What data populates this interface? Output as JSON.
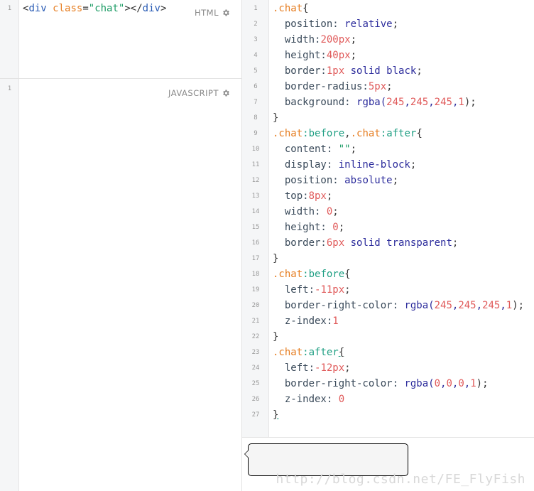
{
  "html_pane": {
    "label": "HTML",
    "line_numbers": [
      "1"
    ],
    "code": {
      "open_lt": "<",
      "tag": "div",
      "space": " ",
      "attr": "class",
      "eq": "=",
      "value": "\"chat\"",
      "close_gt": ">",
      "end_tag_open": "</",
      "end_tag": "div",
      "end_gt": ">"
    }
  },
  "js_pane": {
    "label": "JAVASCRIPT",
    "line_numbers": [
      "1"
    ]
  },
  "css_pane": {
    "line_numbers": [
      "1",
      "2",
      "3",
      "4",
      "5",
      "6",
      "7",
      "8",
      "9",
      "10",
      "11",
      "12",
      "13",
      "14",
      "15",
      "16",
      "17",
      "18",
      "19",
      "20",
      "21",
      "22",
      "23",
      "24",
      "25",
      "26",
      "27"
    ],
    "lines": [
      [
        {
          "t": ".chat",
          "c": "t-sel"
        },
        {
          "t": "{",
          "c": "t-punc"
        }
      ],
      [
        {
          "t": "  position: ",
          "c": "t-prop"
        },
        {
          "t": "relative",
          "c": "t-kw"
        },
        {
          "t": ";",
          "c": "t-punc"
        }
      ],
      [
        {
          "t": "  width:",
          "c": "t-prop"
        },
        {
          "t": "200px",
          "c": "t-num"
        },
        {
          "t": ";",
          "c": "t-punc"
        }
      ],
      [
        {
          "t": "  height:",
          "c": "t-prop"
        },
        {
          "t": "40px",
          "c": "t-num"
        },
        {
          "t": ";",
          "c": "t-punc"
        }
      ],
      [
        {
          "t": "  border:",
          "c": "t-prop"
        },
        {
          "t": "1px",
          "c": "t-num"
        },
        {
          "t": " solid ",
          "c": "t-kw"
        },
        {
          "t": "black",
          "c": "t-kw"
        },
        {
          "t": ";",
          "c": "t-punc"
        }
      ],
      [
        {
          "t": "  border-radius:",
          "c": "t-prop"
        },
        {
          "t": "5px",
          "c": "t-num"
        },
        {
          "t": ";",
          "c": "t-punc"
        }
      ],
      [
        {
          "t": "  background: ",
          "c": "t-prop"
        },
        {
          "t": "rgba(",
          "c": "t-kw"
        },
        {
          "t": "245",
          "c": "t-num"
        },
        {
          "t": ",",
          "c": "t-kw"
        },
        {
          "t": "245",
          "c": "t-num"
        },
        {
          "t": ",",
          "c": "t-kw"
        },
        {
          "t": "245",
          "c": "t-num"
        },
        {
          "t": ",",
          "c": "t-kw"
        },
        {
          "t": "1",
          "c": "t-num"
        },
        {
          "t": ");",
          "c": "t-punc"
        }
      ],
      [
        {
          "t": "}",
          "c": "t-punc"
        }
      ],
      [
        {
          "t": ".chat",
          "c": "t-sel"
        },
        {
          "t": ":before",
          "c": "t-pseudo"
        },
        {
          "t": ",",
          "c": "t-punc"
        },
        {
          "t": ".chat",
          "c": "t-sel"
        },
        {
          "t": ":after",
          "c": "t-pseudo"
        },
        {
          "t": "{",
          "c": "t-punc"
        }
      ],
      [
        {
          "t": "  content: ",
          "c": "t-prop"
        },
        {
          "t": "\"\"",
          "c": "t-str"
        },
        {
          "t": ";",
          "c": "t-punc"
        }
      ],
      [
        {
          "t": "  display: ",
          "c": "t-prop"
        },
        {
          "t": "inline-block",
          "c": "t-kw"
        },
        {
          "t": ";",
          "c": "t-punc"
        }
      ],
      [
        {
          "t": "  position: ",
          "c": "t-prop"
        },
        {
          "t": "absolute",
          "c": "t-kw"
        },
        {
          "t": ";",
          "c": "t-punc"
        }
      ],
      [
        {
          "t": "  top:",
          "c": "t-prop"
        },
        {
          "t": "8px",
          "c": "t-num"
        },
        {
          "t": ";",
          "c": "t-punc"
        }
      ],
      [
        {
          "t": "  width: ",
          "c": "t-prop"
        },
        {
          "t": "0",
          "c": "t-num"
        },
        {
          "t": ";",
          "c": "t-punc"
        }
      ],
      [
        {
          "t": "  height: ",
          "c": "t-prop"
        },
        {
          "t": "0",
          "c": "t-num"
        },
        {
          "t": ";",
          "c": "t-punc"
        }
      ],
      [
        {
          "t": "  border:",
          "c": "t-prop"
        },
        {
          "t": "6px",
          "c": "t-num"
        },
        {
          "t": " solid ",
          "c": "t-kw"
        },
        {
          "t": "transparent",
          "c": "t-kw"
        },
        {
          "t": ";",
          "c": "t-punc"
        }
      ],
      [
        {
          "t": "}",
          "c": "t-punc"
        }
      ],
      [
        {
          "t": ".chat",
          "c": "t-sel"
        },
        {
          "t": ":before",
          "c": "t-pseudo"
        },
        {
          "t": "{",
          "c": "t-punc"
        }
      ],
      [
        {
          "t": "  left:",
          "c": "t-prop"
        },
        {
          "t": "-11px",
          "c": "t-num"
        },
        {
          "t": ";",
          "c": "t-punc"
        }
      ],
      [
        {
          "t": "  border-right-color: ",
          "c": "t-prop"
        },
        {
          "t": "rgba(",
          "c": "t-kw"
        },
        {
          "t": "245",
          "c": "t-num"
        },
        {
          "t": ",",
          "c": "t-kw"
        },
        {
          "t": "245",
          "c": "t-num"
        },
        {
          "t": ",",
          "c": "t-kw"
        },
        {
          "t": "245",
          "c": "t-num"
        },
        {
          "t": ",",
          "c": "t-kw"
        },
        {
          "t": "1",
          "c": "t-num"
        },
        {
          "t": ");",
          "c": "t-punc"
        }
      ],
      [
        {
          "t": "  z-index:",
          "c": "t-prop"
        },
        {
          "t": "1",
          "c": "t-num"
        }
      ],
      [
        {
          "t": "}",
          "c": "t-punc"
        }
      ],
      [
        {
          "t": ".chat",
          "c": "t-sel"
        },
        {
          "t": ":after",
          "c": "t-pseudo"
        },
        {
          "t": "{",
          "c": "t-punc underline"
        }
      ],
      [
        {
          "t": "  left:",
          "c": "t-prop"
        },
        {
          "t": "-12px",
          "c": "t-num"
        },
        {
          "t": ";",
          "c": "t-punc"
        }
      ],
      [
        {
          "t": "  border-right-color: ",
          "c": "t-prop"
        },
        {
          "t": "rgba(",
          "c": "t-kw"
        },
        {
          "t": "0",
          "c": "t-num"
        },
        {
          "t": ",",
          "c": "t-kw"
        },
        {
          "t": "0",
          "c": "t-num"
        },
        {
          "t": ",",
          "c": "t-kw"
        },
        {
          "t": "0",
          "c": "t-num"
        },
        {
          "t": ",",
          "c": "t-kw"
        },
        {
          "t": "1",
          "c": "t-num"
        },
        {
          "t": ");",
          "c": "t-punc"
        }
      ],
      [
        {
          "t": "  z-index: ",
          "c": "t-prop"
        },
        {
          "t": "0",
          "c": "t-num"
        }
      ],
      [
        {
          "t": "}",
          "c": "t-punc underline"
        }
      ]
    ]
  },
  "result_pane": {
    "watermark": "http://blog.csdn.net/FE_FlyFish"
  },
  "icons": {
    "html_settings": "gear-icon",
    "js_settings": "gear-icon"
  },
  "colors": {
    "selector": "#e67e22",
    "pseudo": "#1f9f83",
    "number": "#e05a5a",
    "keyword": "#2c2c9c",
    "string": "#1a9b64",
    "gutter_bg": "#f5f6f7"
  }
}
